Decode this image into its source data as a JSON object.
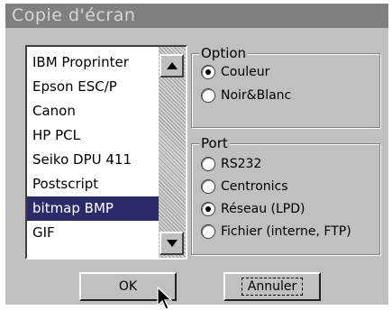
{
  "dialog": {
    "title": "Copie d'écran"
  },
  "printer_list": {
    "items": [
      "IBM Proprinter",
      "Epson ESC/P",
      "Canon",
      "HP PCL",
      "Seiko DPU 411",
      "Postscript",
      "bitmap BMP",
      "GIF"
    ],
    "selected": "bitmap BMP"
  },
  "option_group": {
    "legend": "Option",
    "options": [
      "Couleur",
      "Noir&Blanc"
    ],
    "selected": "Couleur"
  },
  "port_group": {
    "legend": "Port",
    "options": [
      "RS232",
      "Centronics",
      "Réseau (LPD)",
      "Fichier (interne, FTP)"
    ],
    "selected": "Réseau (LPD)"
  },
  "buttons": {
    "ok_label": "OK",
    "cancel_label": "Annuler"
  },
  "icons": {
    "scroll_up": "triangle-up-icon",
    "scroll_down": "triangle-down-icon",
    "pointer": "mouse-cursor-icon"
  },
  "colors": {
    "titlebar": "#808080",
    "dialog_bg": "#c0c0c0",
    "selection": "#2b2b6a"
  }
}
